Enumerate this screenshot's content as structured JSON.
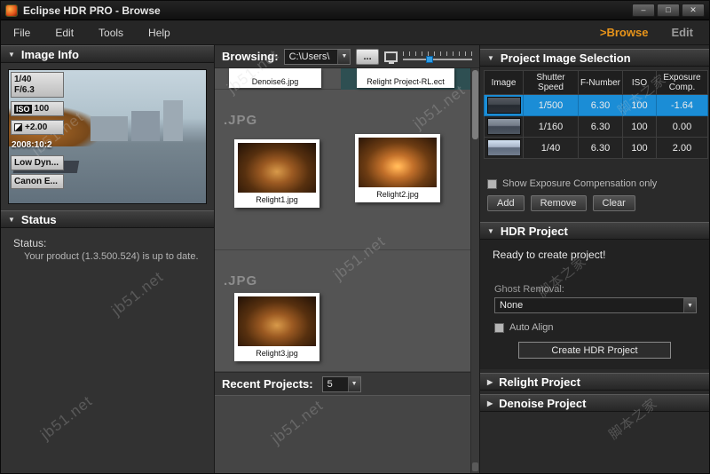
{
  "icons": {
    "tri_down": "▼",
    "tri_right": "▶",
    "dd": "▼"
  },
  "window": {
    "title": "Eclipse HDR PRO - Browse",
    "minimize": "–",
    "maximize": "□",
    "close": "✕"
  },
  "menu": {
    "items": [
      "File",
      "Edit",
      "Tools",
      "Help"
    ],
    "browse": ">Browse",
    "edit": "Edit"
  },
  "left": {
    "image_info_title": "Image Info",
    "exif": {
      "shutter": "1/40",
      "aperture": "F/6.3",
      "iso_label": "ISO",
      "iso": "100",
      "ev": "+2.00",
      "date": "2008:10:2",
      "dynamic": "Low Dyn...",
      "camera": "Canon E..."
    },
    "status_title": "Status",
    "status_label": "Status:",
    "status_message": "Your product (1.3.500.524) is up to date."
  },
  "center": {
    "browsing_label": "Browsing:",
    "path": "C:\\Users\\",
    "browse_button": "...",
    "files": {
      "row1": [
        {
          "name": "Denoise6.jpg"
        },
        {
          "name": "Relight Project-RL.ect"
        }
      ],
      "group2_label": ".JPG",
      "group2": [
        {
          "name": "Relight1.jpg"
        },
        {
          "name": "Relight2.jpg"
        }
      ],
      "group3_label": ".JPG",
      "group3": [
        {
          "name": "Relight3.jpg"
        }
      ]
    },
    "recent_label": "Recent Projects:",
    "recent_value": "5"
  },
  "right": {
    "selection_title": "Project Image Selection",
    "columns": [
      "Image",
      "Shutter Speed",
      "F-Number",
      "ISO",
      "Exposure Comp."
    ],
    "rows": [
      {
        "shutter": "1/500",
        "f": "6.30",
        "iso": "100",
        "ev": "-1.64"
      },
      {
        "shutter": "1/160",
        "f": "6.30",
        "iso": "100",
        "ev": "0.00"
      },
      {
        "shutter": "1/40",
        "f": "6.30",
        "iso": "100",
        "ev": "2.00"
      }
    ],
    "show_ev_only": "Show Exposure Compensation only",
    "add": "Add",
    "remove": "Remove",
    "clear": "Clear",
    "hdr_title": "HDR Project",
    "ready": "Ready to create project!",
    "ghost_label": "Ghost Removal:",
    "ghost_value": "None",
    "auto_align": "Auto Align",
    "create_button": "Create HDR Project",
    "relight_title": "Relight Project",
    "denoise_title": "Denoise Project"
  },
  "watermark": {
    "site": "jb51.net",
    "cn": "脚本之家"
  }
}
